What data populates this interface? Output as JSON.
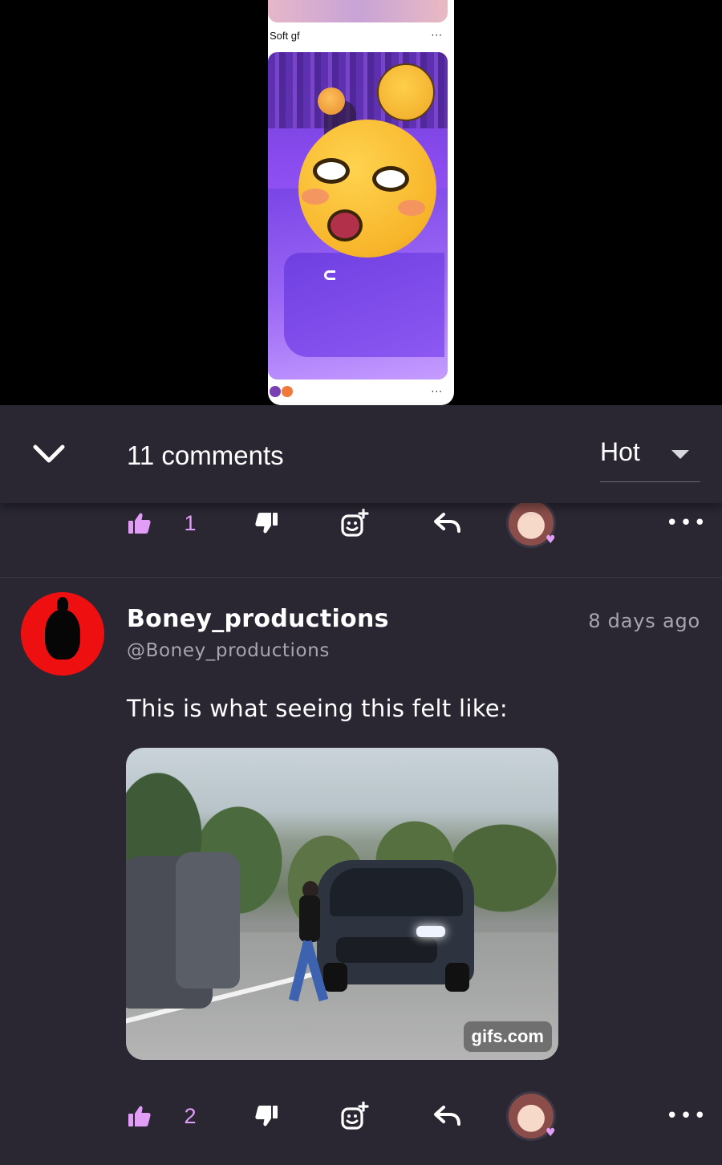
{
  "post_preview": {
    "pin_title": "Soft gf",
    "more_glyph": "···",
    "emojis": [
      "purple-heart",
      "peach"
    ]
  },
  "comments_header": {
    "title": "11 comments",
    "sort": {
      "selected": "Hot"
    }
  },
  "first_actions": {
    "like_count": "1",
    "more_glyph": "•••"
  },
  "comment": {
    "author": "Boney_productions",
    "handle": "@Boney_productions",
    "time": "8 days ago",
    "text": "This is what seeing this felt like:",
    "gif_badge": "gifs.com"
  },
  "second_actions": {
    "like_count": "2",
    "more_glyph": "•••"
  },
  "colors": {
    "background": "#2a2733",
    "accent": "#e29ef7",
    "muted_text": "#a8a5b0",
    "avatar_red": "#ee1010"
  },
  "icons": [
    "chevron-down-icon",
    "thumbs-up-icon",
    "thumbs-down-icon",
    "add-reaction-icon",
    "reply-icon",
    "more-icon",
    "caret-down-icon"
  ]
}
